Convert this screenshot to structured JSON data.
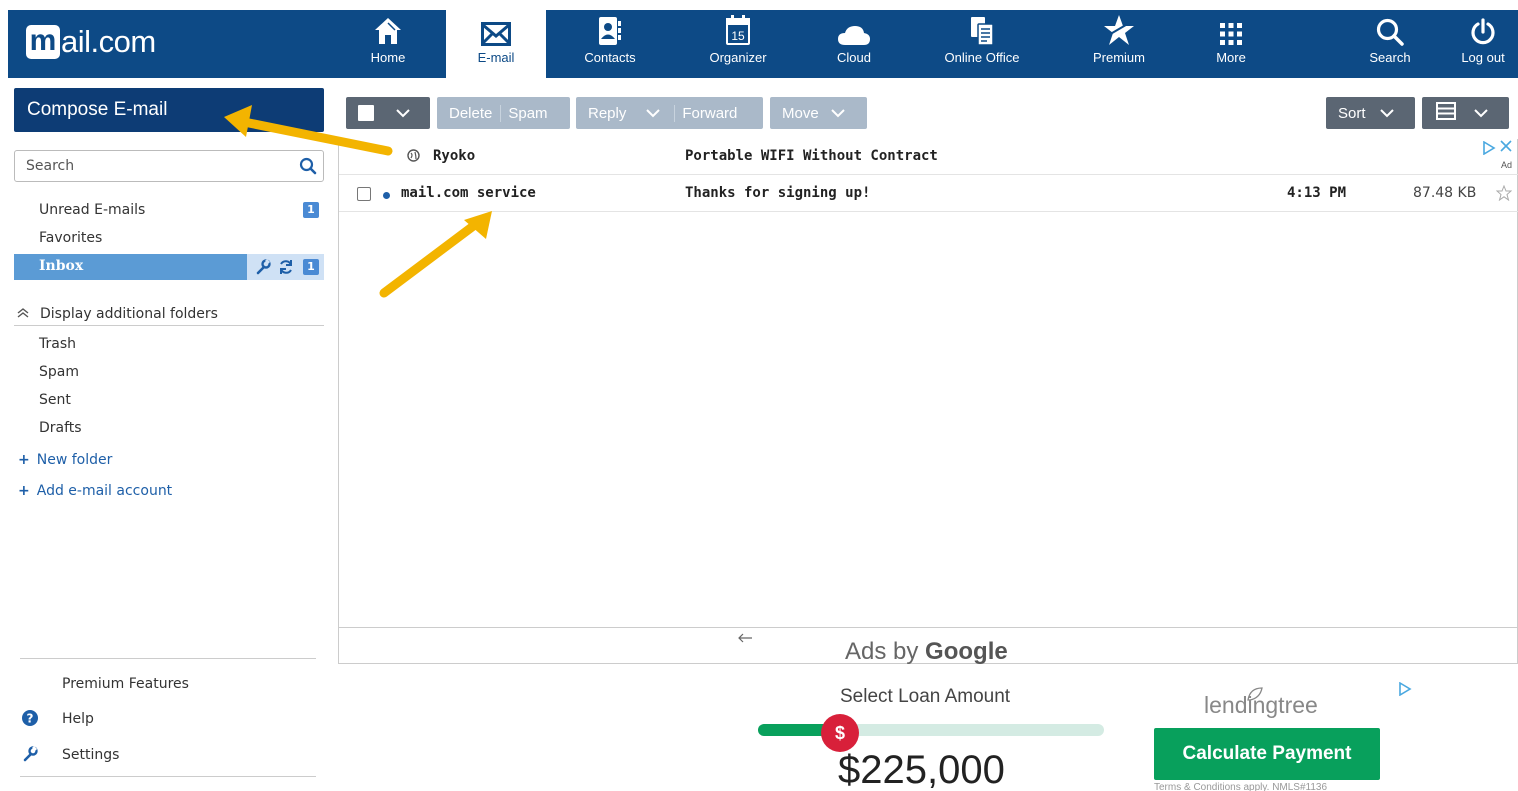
{
  "header": {
    "logo_m": "m",
    "logo_text": "ail.com",
    "nav": [
      {
        "label": "Home",
        "icon": "home-icon"
      },
      {
        "label": "E-mail",
        "icon": "envelope-icon",
        "active": true
      },
      {
        "label": "Contacts",
        "icon": "contacts-icon"
      },
      {
        "label": "Organizer",
        "icon": "calendar-icon",
        "icon_text": "15"
      },
      {
        "label": "Cloud",
        "icon": "cloud-icon"
      },
      {
        "label": "Online Office",
        "icon": "office-icon"
      },
      {
        "label": "Premium",
        "icon": "star-icon"
      },
      {
        "label": "More",
        "icon": "grid-icon"
      },
      {
        "label": "Search",
        "icon": "search-icon"
      },
      {
        "label": "Log out",
        "icon": "power-icon"
      }
    ]
  },
  "sidebar": {
    "compose_label": "Compose E-mail",
    "search_placeholder": "Search",
    "unread_label": "Unread E-mails",
    "unread_count": "1",
    "favorites_label": "Favorites",
    "inbox_label": "Inbox",
    "inbox_count": "1",
    "display_folders_label": "Display additional folders",
    "folders": [
      "Trash",
      "Spam",
      "Sent",
      "Drafts"
    ],
    "new_folder_label": "New folder",
    "add_account_label": "Add e-mail account",
    "premium_label": "Premium Features",
    "help_label": "Help",
    "settings_label": "Settings"
  },
  "toolbar": {
    "delete_label": "Delete",
    "spam_label": "Spam",
    "reply_label": "Reply",
    "forward_label": "Forward",
    "move_label": "Move",
    "sort_label": "Sort"
  },
  "messages": [
    {
      "sender": "Ryoko",
      "subject": "Portable WIFI Without Contract",
      "time": "",
      "size": "",
      "sponsored": true
    },
    {
      "sender": "mail.com service",
      "subject": "Thanks for signing up!",
      "time": "4:13 PM",
      "size": "87.48 KB",
      "unread": true
    }
  ],
  "ads": {
    "ads_by": "Ads by",
    "google": "Google",
    "ad_marker": "Ad",
    "loan_title": "Select Loan Amount",
    "slider_symbol": "$",
    "slider_level": 0.22,
    "loan_amount": "$225,000",
    "brand": "lendingtree",
    "cta": "Calculate Payment",
    "terms": "Terms & Conditions apply. NMLS#1136"
  },
  "colors": {
    "nav_blue": "#0d4a86",
    "compose_blue": "#0d3c75",
    "inbox_blue": "#5b9bd5",
    "arrow": "#f3b400",
    "cta_green": "#08a05c"
  }
}
